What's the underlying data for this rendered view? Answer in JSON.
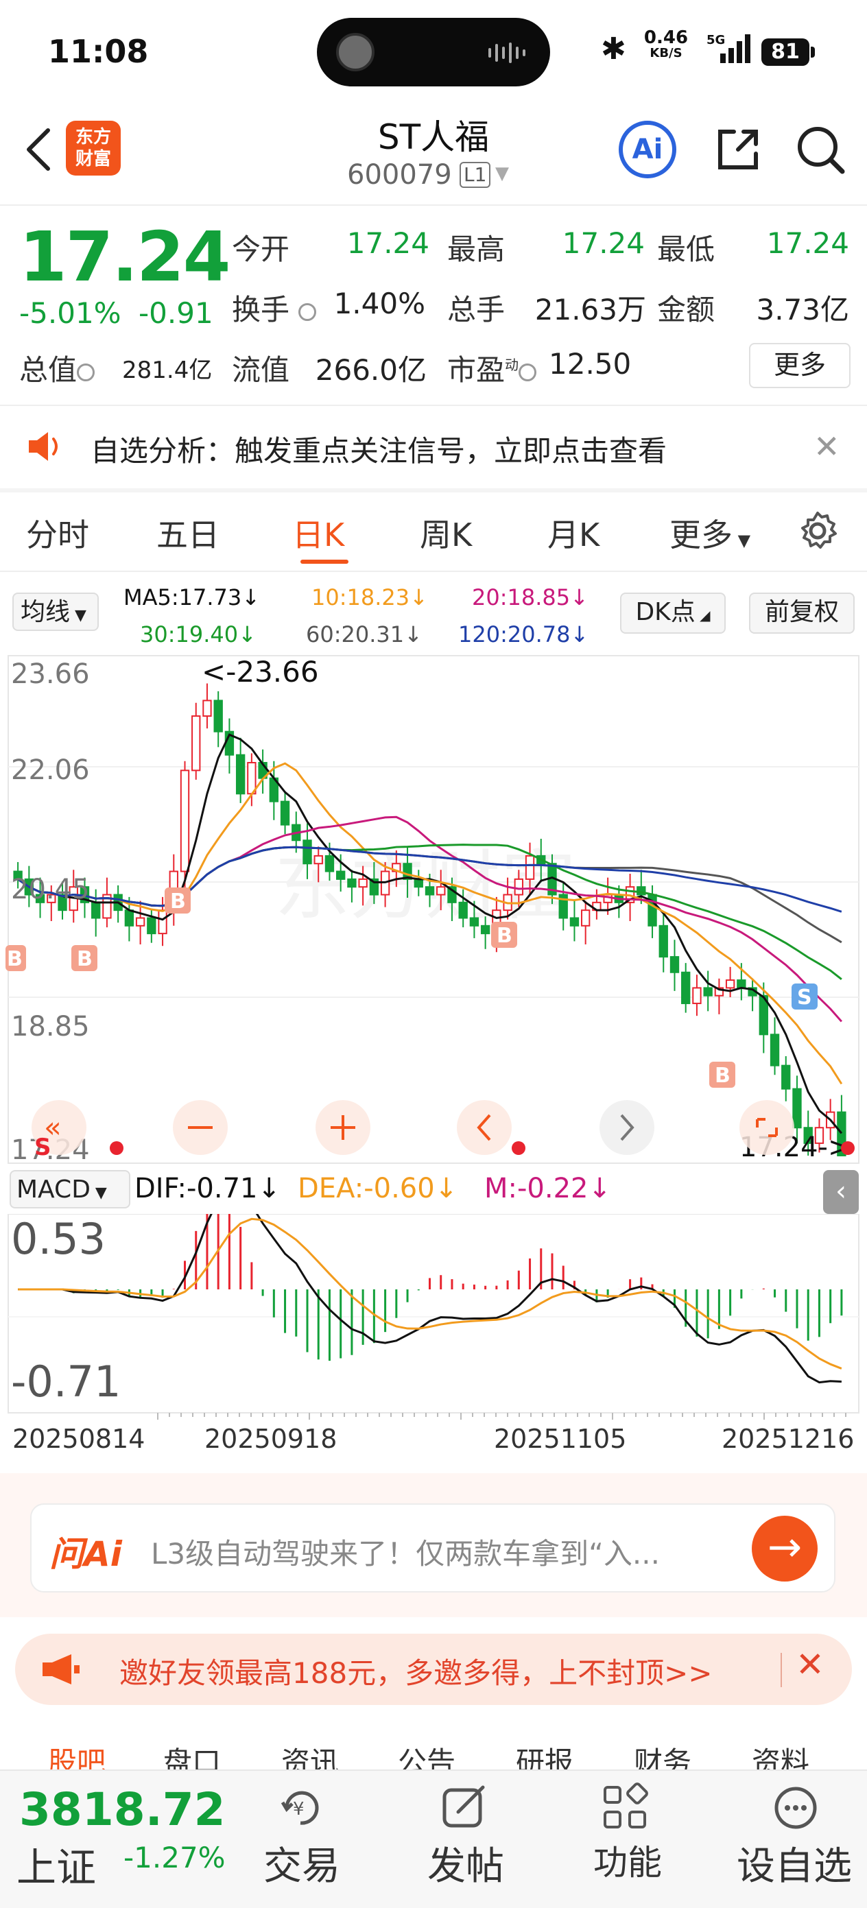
{
  "status_bar": {
    "time": "11:08",
    "net_speed": "0.46",
    "net_unit": "KB/S",
    "signal": "5G",
    "battery": "81"
  },
  "header": {
    "logo_line1": "东方",
    "logo_line2": "财富",
    "stock_name": "ST人福",
    "stock_code": "600079",
    "level": "L1",
    "ai_label": "Ai"
  },
  "quote": {
    "price": "17.24",
    "change_pct": "-5.01%",
    "change": "-0.91",
    "open_label": "今开",
    "open": "17.24",
    "high_label": "最高",
    "high": "17.24",
    "low_label": "最低",
    "low": "17.24",
    "turnover_label": "换手",
    "turnover": "1.40%",
    "volume_label": "总手",
    "volume": "21.63万",
    "amount_label": "金额",
    "amount": "3.73亿",
    "mktcap_label": "总值",
    "mktcap": "281.4亿",
    "float_label": "流值",
    "float_cap": "266.0亿",
    "pe_label": "市盈",
    "pe_sup": "动",
    "pe": "12.50",
    "more_label": "更多"
  },
  "alert": {
    "text": "自选分析：触发重点关注信号，立即点击查看"
  },
  "tabs": [
    "分时",
    "五日",
    "日K",
    "周K",
    "月K",
    "更多"
  ],
  "active_tab": "日K",
  "ma": {
    "select": "均线",
    "ma5": "MA5:17.73",
    "ma10": "10:18.23",
    "ma20": "20:18.85",
    "ma30": "30:19.40",
    "ma60": "60:20.31",
    "ma120": "120:20.78",
    "dk_label": "DK点",
    "adj_label": "前复权",
    "colors": {
      "ma5": "#111111",
      "ma10": "#f29b1d",
      "ma20": "#c8197b",
      "ma30": "#1a9a2a",
      "ma60": "#555555",
      "ma120": "#1f3fa8"
    }
  },
  "kline": {
    "y_labels": [
      "23.66",
      "22.06",
      "20.45",
      "18.85",
      "17.24"
    ],
    "max_marker": "<-23.66",
    "last_marker": "17.24->",
    "signal_b": "B",
    "signal_s": "S"
  },
  "macd": {
    "select": "MACD",
    "dif": "DIF:-0.71",
    "dea": "DEA:-0.60",
    "m": "M:-0.22",
    "y_top": "0.53",
    "y_bottom": "-0.71"
  },
  "dates": [
    "20250814",
    "20250918",
    "20251105",
    "20251216"
  ],
  "ai_banner": {
    "logo": "问Ai",
    "text": "L3级自动驾驶来了！仅两款车拿到“入..."
  },
  "invite_banner": {
    "text": "邀好友领最高188元，多邀多得，上不封顶>>"
  },
  "subtabs": [
    "股吧",
    "盘口",
    "资讯",
    "公告",
    "研报",
    "财务",
    "资料"
  ],
  "bottom_nav": {
    "index_value": "3818.72",
    "index_name": "上证",
    "index_pct": "-1.27%",
    "items": [
      "交易",
      "发帖",
      "功能",
      "设自选"
    ]
  }
}
